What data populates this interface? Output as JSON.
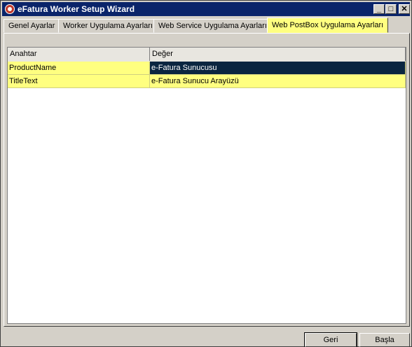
{
  "window": {
    "title": "eFatura Worker Setup Wizard",
    "controls": {
      "minimize": "_",
      "maximize": "□",
      "close": "✕"
    }
  },
  "tabs": [
    {
      "label": "Genel Ayarlar"
    },
    {
      "label": "Worker Uygulama Ayarları"
    },
    {
      "label": "Web Service Uygulama Ayarları"
    },
    {
      "label": "Web PostBox Uygulama Ayarları",
      "active": true
    }
  ],
  "grid": {
    "columns": [
      "Anahtar",
      "Değer"
    ],
    "rows": [
      {
        "key": "ProductName",
        "value": "e-Fatura Sunucusu"
      },
      {
        "key": "TitleText",
        "value": "e-Fatura Sunucu Arayüzü"
      }
    ],
    "row_color": "#ffff80",
    "selected_color": "#0a2540"
  },
  "buttons": {
    "back": "Geri",
    "start": "Başla"
  },
  "colors": {
    "titlebar": "#0a246a",
    "active_tab": "#ffff80",
    "window_bg": "#d4d0c8"
  }
}
